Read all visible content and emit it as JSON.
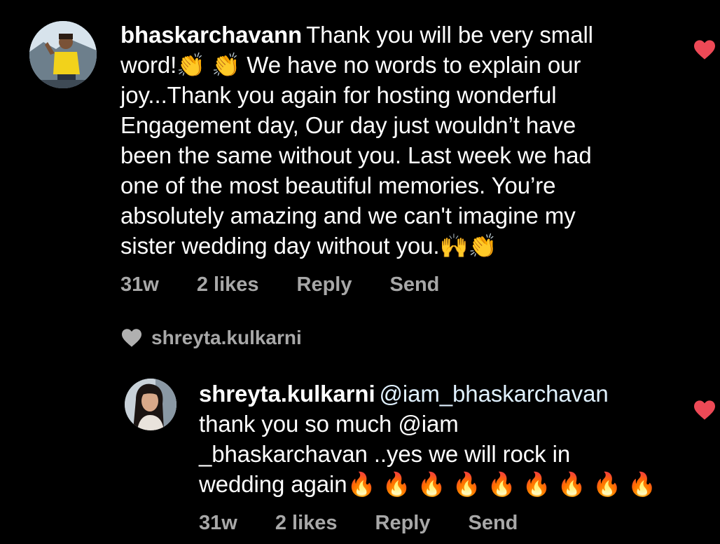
{
  "comments": [
    {
      "username": "bhaskarchavann",
      "lines": [
        "Thank you will be very small",
        "word!👏 👏  We have no words to explain our",
        "joy...Thank you again for hosting wonderful",
        "Engagement day, Our day just wouldn’t have",
        "been the same without you.  Last week we had",
        "one of the most beautiful memories. You’re",
        "absolutely amazing and we can't imagine my",
        "sister wedding day without you.🙌👏"
      ],
      "time": "31w",
      "likes": "2 likes",
      "reply": "Reply",
      "send": "Send",
      "liked": true
    }
  ],
  "liked_by": {
    "username": "shreyta.kulkarni",
    "icon": "heart-icon"
  },
  "reply": {
    "username": "shreyta.kulkarni",
    "mention": "@iam_bhaskarchavan",
    "lines": [
      "thank you so much @iam",
      "_bhaskarchavan ..yes we will rock in",
      "wedding again🔥 🔥 🔥 🔥 🔥 🔥 🔥 🔥 🔥"
    ],
    "time": "31w",
    "likes": "2 likes",
    "reply": "Reply",
    "send": "Send",
    "liked": true
  },
  "colors": {
    "background": "#000000",
    "text": "#ffffff",
    "meta": "#a8a8a8",
    "heart_liked": "#ed4956"
  }
}
